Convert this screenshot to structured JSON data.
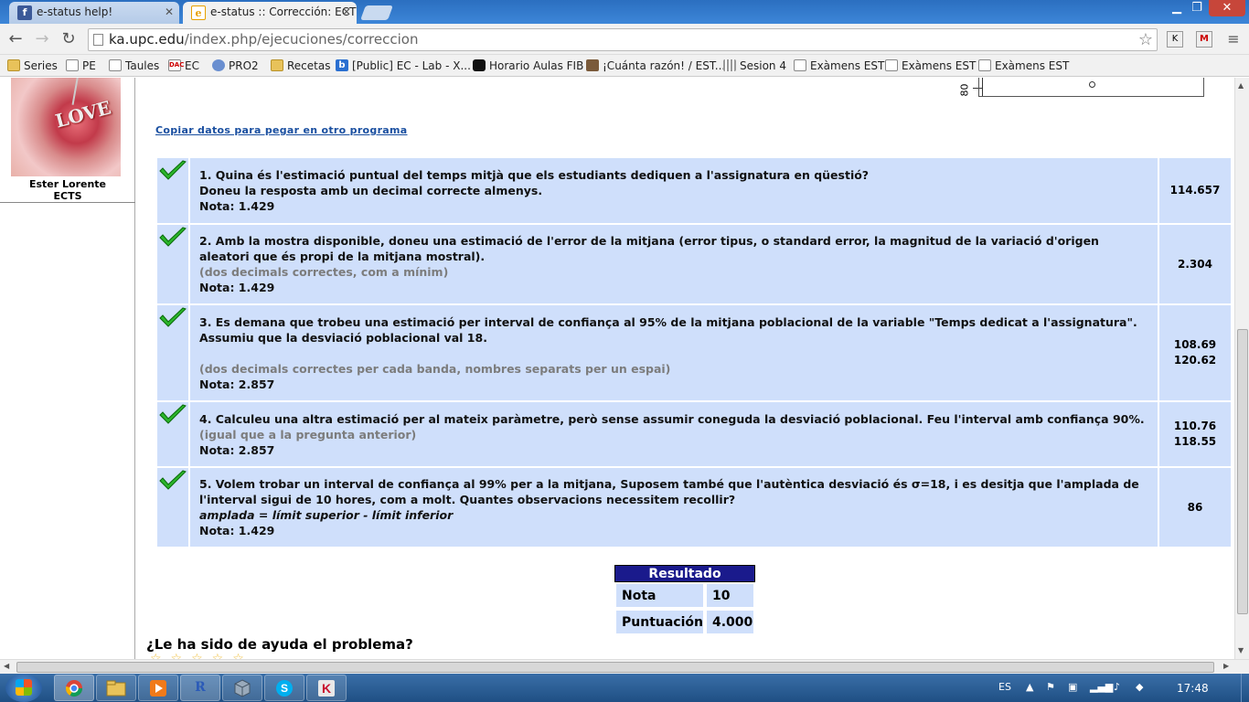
{
  "browser": {
    "tabs": [
      {
        "title": "e-status help!",
        "icon": "facebook-icon",
        "active": false
      },
      {
        "title": "e-status :: Corrección: ECTS",
        "icon": "ie-icon",
        "active": true
      }
    ],
    "url_host": "ka.upc.edu",
    "url_path": "/index.php/ejecuciones/correccion",
    "bookmarks": [
      {
        "label": "Series",
        "icon": "folder-icon"
      },
      {
        "label": "PE",
        "icon": "page-icon"
      },
      {
        "label": "Taules",
        "icon": "page-icon"
      },
      {
        "label": "EC",
        "icon": "dac-icon"
      },
      {
        "label": "PRO2",
        "icon": "globe-icon"
      },
      {
        "label": "Recetas",
        "icon": "folder-icon"
      },
      {
        "label": "[Public] EC - Lab - X...",
        "icon": "b-icon"
      },
      {
        "label": "Horario Aulas FIB",
        "icon": "person-icon"
      },
      {
        "label": "¡Cuánta razón! / EST...",
        "icon": "picture-icon"
      },
      {
        "label": "Sesion 4",
        "icon": "grid-icon"
      },
      {
        "label": "Exàmens EST",
        "icon": "page-icon"
      },
      {
        "label": "Exàmens EST",
        "icon": "page-icon"
      },
      {
        "label": "Exàmens EST",
        "icon": "page-icon"
      }
    ],
    "extension_icons": [
      "K",
      "M"
    ]
  },
  "sidebar": {
    "avatar_text": "LOVE",
    "user_name": "Ester Lorente",
    "user_group": "ECTS"
  },
  "graph_fragment": {
    "axis_label": "80"
  },
  "copy_link": "Copiar datos para pegar en otro programa",
  "questions": [
    {
      "status": "correct",
      "lines": [
        "1. Quina és l'estimació puntual del temps mitjà que els estudiants dediquen a l'assignatura en qüestió?",
        "Doneu la resposta amb un decimal correcte almenys."
      ],
      "hint": "",
      "italic": "",
      "grade": "Nota: 1.429",
      "answer": [
        "114.657"
      ]
    },
    {
      "status": "correct",
      "lines": [
        "2. Amb la mostra disponible, doneu una estimació de l'error de la mitjana (error tipus, o standard error, la magnitud de la variació d'origen aleatori que és propi de la mitjana mostral)."
      ],
      "hint": "(dos decimals correctes, com a mínim)",
      "italic": "",
      "grade": "Nota: 1.429",
      "answer": [
        "2.304"
      ]
    },
    {
      "status": "correct",
      "lines": [
        "3. Es demana que trobeu una estimació per interval de confiança al 95% de la mitjana poblacional de la variable \"Temps dedicat a l'assignatura\". Assumiu que la desviació poblacional val 18."
      ],
      "hint": "(dos decimals correctes per cada banda, nombres separats per un espai)",
      "italic": "",
      "grade": "Nota: 2.857",
      "answer": [
        "108.69",
        "120.62"
      ]
    },
    {
      "status": "correct",
      "lines": [
        "4. Calculeu una altra estimació per al mateix paràmetre, però sense assumir coneguda la desviació poblacional. Feu l'interval amb confiança 90%."
      ],
      "hint": "(igual que a la pregunta anterior)",
      "italic": "",
      "grade": "Nota: 2.857",
      "answer": [
        "110.76",
        "118.55"
      ]
    },
    {
      "status": "correct",
      "lines": [
        "5. Volem trobar un interval de confiança al 99% per a la mitjana, Suposem també que l'autèntica desviació és σ=18, i es desitja que l'amplada de l'interval sigui de 10 hores, com a molt. Quantes observacions necessitem recollir?"
      ],
      "hint": "",
      "italic": "amplada = límit superior - límit inferior",
      "grade": "Nota: 1.429",
      "answer": [
        "86"
      ]
    }
  ],
  "result": {
    "header": "Resultado",
    "rows": [
      {
        "label": "Nota",
        "value": "10"
      },
      {
        "label": "Puntuación",
        "value": "4.000"
      }
    ]
  },
  "help_question": "¿Le ha sido de ayuda el problema?",
  "taskbar": {
    "language": "ES",
    "time": "17:48",
    "apps": [
      "chrome-icon",
      "explorer-icon",
      "media-player-icon",
      "r-icon",
      "virtualbox-icon",
      "skype-icon",
      "kaspersky-icon"
    ]
  },
  "colors": {
    "row_bg": "#cfdffb",
    "result_header_bg": "#1a1a8c",
    "hint_grey": "#7c7c7c",
    "check_green": "#2bb52b"
  }
}
